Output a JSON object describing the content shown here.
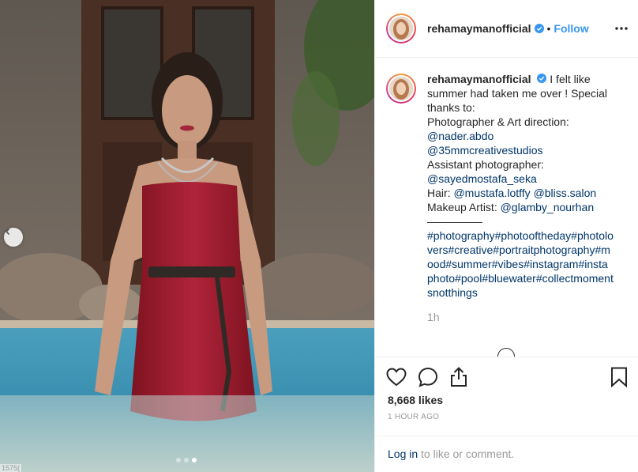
{
  "post": {
    "username": "rehamaymanofficial",
    "follow_label": "Follow",
    "separator": "•"
  },
  "caption": {
    "username": "rehamaymanofficial",
    "text_1": "I felt like summer had taken me over ! Special thanks to:",
    "line_photographer": "Photographer & Art direction:",
    "mention_1": "@nader.abdo",
    "mention_2": "@35mmcreativestudios",
    "line_assistant": "Assistant photographer:",
    "mention_3": "@sayedmostafa_seka",
    "hair_label": "Hair: ",
    "mention_4": "@mustafa.lotffy",
    "mention_5": "@bliss.salon",
    "makeup_label": "Makeup Artist: ",
    "mention_6": "@glamby_nourhan",
    "divider": "—————",
    "hashtags": [
      "#photography",
      "#photooftheday",
      "#photolovers",
      "#creative",
      "#portraitphotography",
      "#mood",
      "#summer",
      "#vibes",
      "#instagram",
      "#instaphoto",
      "#pool",
      "#bluewater",
      "#collectmomentsnotthings"
    ],
    "time_ago": "1h"
  },
  "stats": {
    "likes": "8,668 likes",
    "timestamp": "1 HOUR AGO"
  },
  "footer": {
    "login_link": "Log in",
    "login_rest": " to like or comment."
  },
  "photo": {
    "corner_tag": "1575(",
    "carousel_active_index": 3,
    "carousel_count": 3
  },
  "icons": {
    "verified": "verified-badge-icon",
    "more": "more-options-icon",
    "like": "heart-icon",
    "comment": "comment-icon",
    "share": "share-icon",
    "save": "bookmark-icon",
    "prev": "chevron-left-icon"
  },
  "colors": {
    "link": "#003569",
    "follow": "#3897f0",
    "dress": "#a01c2c",
    "water": "#3a8fb0"
  }
}
